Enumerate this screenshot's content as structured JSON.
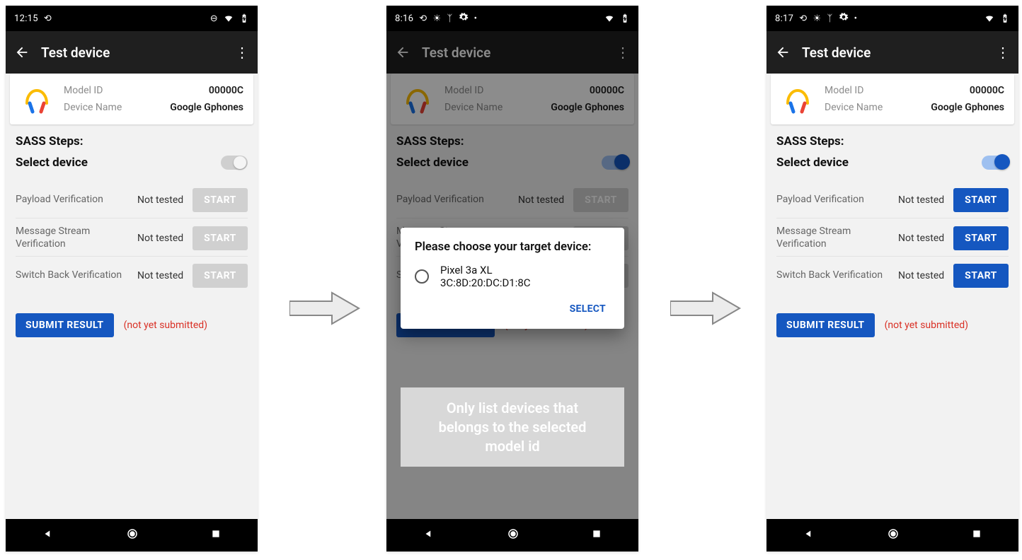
{
  "screens": [
    {
      "time": "12:15",
      "statusIcons": [
        "loop"
      ],
      "rightIcons": [
        "dnd",
        "wifi",
        "batt"
      ],
      "appbarTitle": "Test device",
      "toggle": "off",
      "startStyle": "gray"
    },
    {
      "time": "8:16",
      "statusIcons": [
        "loop",
        "sun",
        "fork",
        "gear",
        "dot"
      ],
      "rightIcons": [
        "wifi",
        "batt"
      ],
      "appbarTitle": "Test device",
      "toggle": "on",
      "startStyle": "gray"
    },
    {
      "time": "8:17",
      "statusIcons": [
        "loop",
        "sun",
        "fork",
        "gear",
        "dot"
      ],
      "rightIcons": [
        "wifi",
        "batt"
      ],
      "appbarTitle": "Test device",
      "toggle": "on",
      "startStyle": "blue"
    }
  ],
  "card": {
    "modelIdLabel": "Model ID",
    "modelIdValue": "00000C",
    "deviceNameLabel": "Device Name",
    "deviceNameValue": "Google Gphones"
  },
  "sectionTitle": "SASS Steps:",
  "selectDeviceLabel": "Select device",
  "tests": [
    {
      "name": "Payload Verification",
      "status": "Not tested",
      "start": "START"
    },
    {
      "name": "Message Stream Verification",
      "status": "Not tested",
      "start": "START"
    },
    {
      "name": "Switch Back Verification",
      "status": "Not tested",
      "start": "START"
    }
  ],
  "submit": {
    "label": "SUBMIT RESULT",
    "note": "(not yet submitted)"
  },
  "dialog": {
    "title": "Please choose your target device:",
    "optionTitle": "Pixel 3a XL",
    "optionMac": "3C:8D:20:DC:D1:8C",
    "action": "SELECT"
  },
  "overlayNote": "Only list devices that belongs to the selected model id"
}
